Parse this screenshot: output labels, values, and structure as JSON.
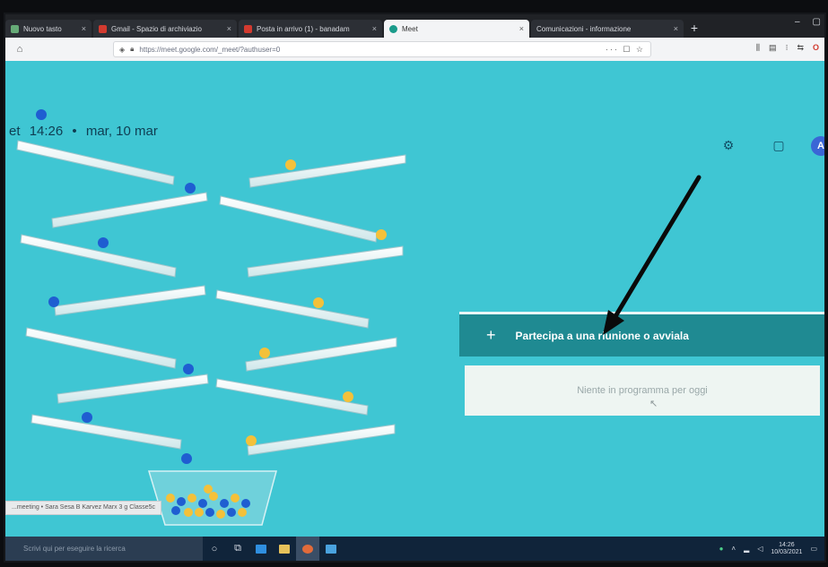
{
  "browser": {
    "tabs": [
      {
        "label": "Nuovo tasto",
        "favicon": "generic",
        "active": false
      },
      {
        "label": "Gmail - Spazio di archiviazio",
        "favicon": "gmail",
        "active": false
      },
      {
        "label": "Posta in arrivo (1) - banadam",
        "favicon": "mail",
        "active": false
      },
      {
        "label": "Meet",
        "favicon": "meet",
        "active": true
      },
      {
        "label": "Comunicazioni - informazione",
        "favicon": "generic",
        "active": false
      }
    ],
    "tab_close": "×",
    "new_tab": "+",
    "window_controls": [
      "–",
      "▢"
    ],
    "url": "https://meet.google.com/_meet/?authuser=0",
    "url_actions": "··· ☐ ☆"
  },
  "meet": {
    "brand_fragment": "et",
    "time": "14:26",
    "separator": "•",
    "date": "mar, 10 mar",
    "join_button": {
      "icon": "+",
      "label": "Partecipa a una riunione o avviala"
    },
    "empty_state": "Niente in programma per oggi",
    "avatar": "A"
  },
  "status_bar_url": "...meeting  •  Sara Sesa B  Karvez  Marx 3  g  Classe5c",
  "taskbar": {
    "search_placeholder": "Scrivi qui per eseguire la ricerca",
    "clock_time": "14:26",
    "clock_date": "10/03/2021"
  },
  "colors": {
    "page_bg": "#3fc6d3",
    "join_bg": "#1f8a92",
    "ball_blue": "#1f5ed1",
    "ball_yellow": "#f4c13a"
  }
}
